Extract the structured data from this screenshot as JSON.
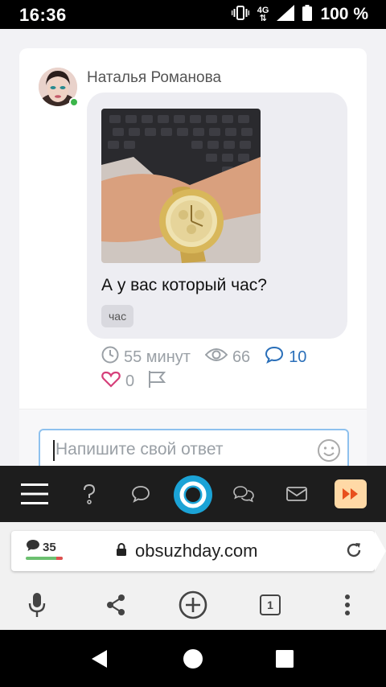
{
  "status_bar": {
    "time": "16:36",
    "network": "4G",
    "battery": "100 %",
    "icons": [
      "vibrate-icon",
      "network-arrows-icon",
      "signal-icon",
      "battery-icon"
    ]
  },
  "post": {
    "author": "Наталья Романова",
    "author_online": true,
    "question": "А у вас который час?",
    "tag": "час",
    "time_ago": "55 минут",
    "views": "66",
    "comments": "10",
    "likes": "0",
    "colors": {
      "accent": "#2a6fb9",
      "like": "#d63f7a",
      "online": "#3bb54a"
    }
  },
  "reply": {
    "placeholder": "Напишите свой ответ"
  },
  "site_nav": {
    "items": [
      "menu-icon",
      "question-icon",
      "chat-bubble-icon",
      "home-logo-icon",
      "chats-icon",
      "mail-icon",
      "fast-forward-icon"
    ]
  },
  "browser": {
    "comments_count": "35",
    "domain": "obsuzhday.com",
    "tabs_count": "1"
  }
}
